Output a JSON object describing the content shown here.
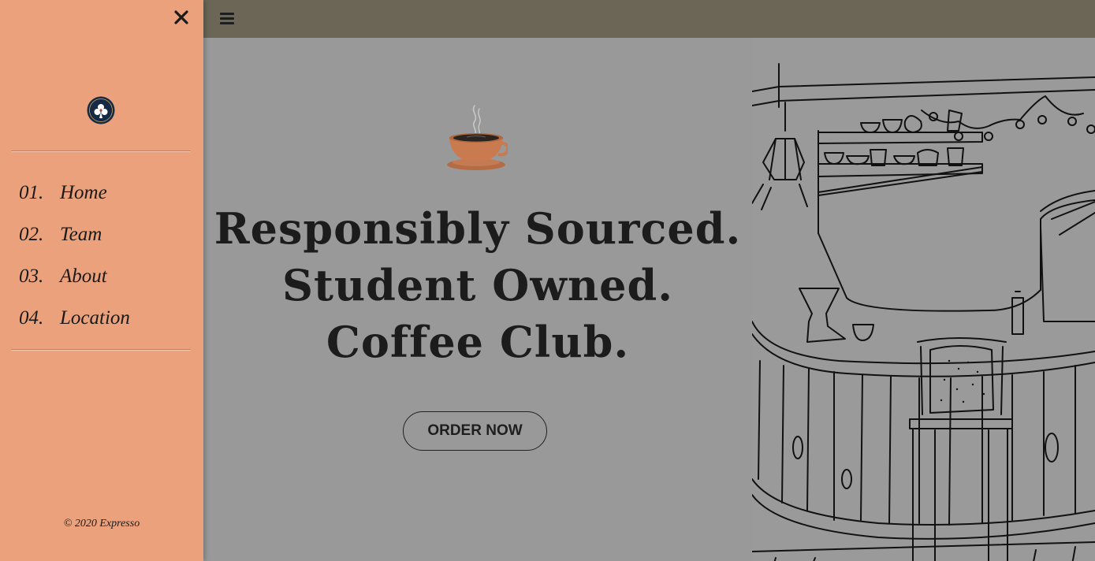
{
  "drawer": {
    "close_icon": "close-icon",
    "logo_icon": "club-logo-icon",
    "nav": [
      {
        "num": "01.",
        "label": "Home"
      },
      {
        "num": "02.",
        "label": "Team"
      },
      {
        "num": "03.",
        "label": "About"
      },
      {
        "num": "04.",
        "label": "Location"
      }
    ],
    "footer": "© 2020 Expresso"
  },
  "topbar": {
    "menu_icon": "hamburger-menu-icon"
  },
  "hero": {
    "cup_icon": "coffee-cup-icon",
    "headline": [
      "Responsibly Sourced.",
      "Student Owned.",
      "Coffee Club."
    ],
    "cta_label": "ORDER NOW",
    "illustration": "coffee-bar-sketch-image"
  },
  "colors": {
    "drawer_bg": "#eba27c",
    "topbar_bg": "#6b6655",
    "page_bg": "#999999",
    "text": "#1c1c1c"
  }
}
